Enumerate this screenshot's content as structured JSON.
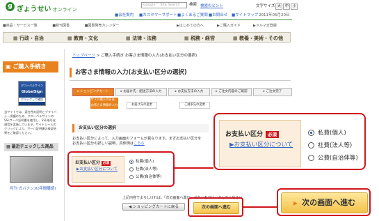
{
  "header": {
    "logo_mark": "g",
    "logo_text": "ぎょうせい",
    "logo_sub": "オンライン",
    "search_placeholder": "Google™ Site Search",
    "search_button": "検索",
    "search_hint": "検索のヒント",
    "font_size_label": "文字サイズ",
    "font_sizes": [
      "大",
      "中",
      "小"
    ],
    "util_links": [
      "会社案内",
      "カスタマーサポート",
      "よくあるご質問",
      "お問合せ",
      "サイトマップ"
    ],
    "date": "2011年05月20日"
  },
  "subnav": {
    "items": [
      "商品・サービス一覧",
      "新刊図書",
      "図書発売カレンダー"
    ],
    "right_items": [
      "はじめての方へ",
      "ご購入ガイド",
      "メルマガ登録"
    ]
  },
  "categories": [
    "行政・自治",
    "教育・文化",
    "法律・法務",
    "税務・経営",
    "教養・美術・その他"
  ],
  "sidebar": {
    "title": "ご購入手続き",
    "seal_title": "グローバルサイン",
    "seal_sub": "GlobalSign",
    "seal_note": "クリックして確認",
    "text": "当サイトでは、実在性の証明とプライバシー保護のため、グローバルサインのSSLサーバ証明書を使用し、SSL暗号化通信を実施しています。サイトシールのクリックにより、サーバ証明書の検証結果をご確認ください。",
    "recent_title": "最近チェックした商品",
    "recent_item": "月刊 ガバナンス(年間購読)"
  },
  "breadcrumb": {
    "home": "トップページ",
    "trail": "ご購入手続き:お客さま情報の入力(お支払い区分の選択)"
  },
  "page_title": "お客さま情報の入力(お支払い区分の選択)",
  "steps": [
    "ショッピングカート",
    "お届け先・配送方法の入力",
    "お支払方法の入力",
    "ご注文内容のご確認",
    "ご注文完了"
  ],
  "step_active_note": "ゲスト購入の方は、お客さま情報の入力",
  "step_sub": [
    "お届け先の変更",
    "ご請求先の変更"
  ],
  "section_title": "お支払い区分の選択",
  "description": "お支払い区分によって、入力画面のフォームが異なります。まずお支払い区分を",
  "description_link": "こちら",
  "description2": "お支払い区分の詳しい説明、具体例は",
  "payment": {
    "label": "お支払い区分",
    "required": "必須",
    "about_link": "お支払い区分について",
    "options": [
      "私費(個人)",
      "社費(法人等)",
      "公費(自治体等)"
    ],
    "selected_index": 0
  },
  "notice": "上記内容でよろしければ、「次の画面へ進む」ボタンをクリックしてください。",
  "buttons": {
    "back": "ショッピングカートに戻る",
    "next": "次の画面へ進む"
  }
}
